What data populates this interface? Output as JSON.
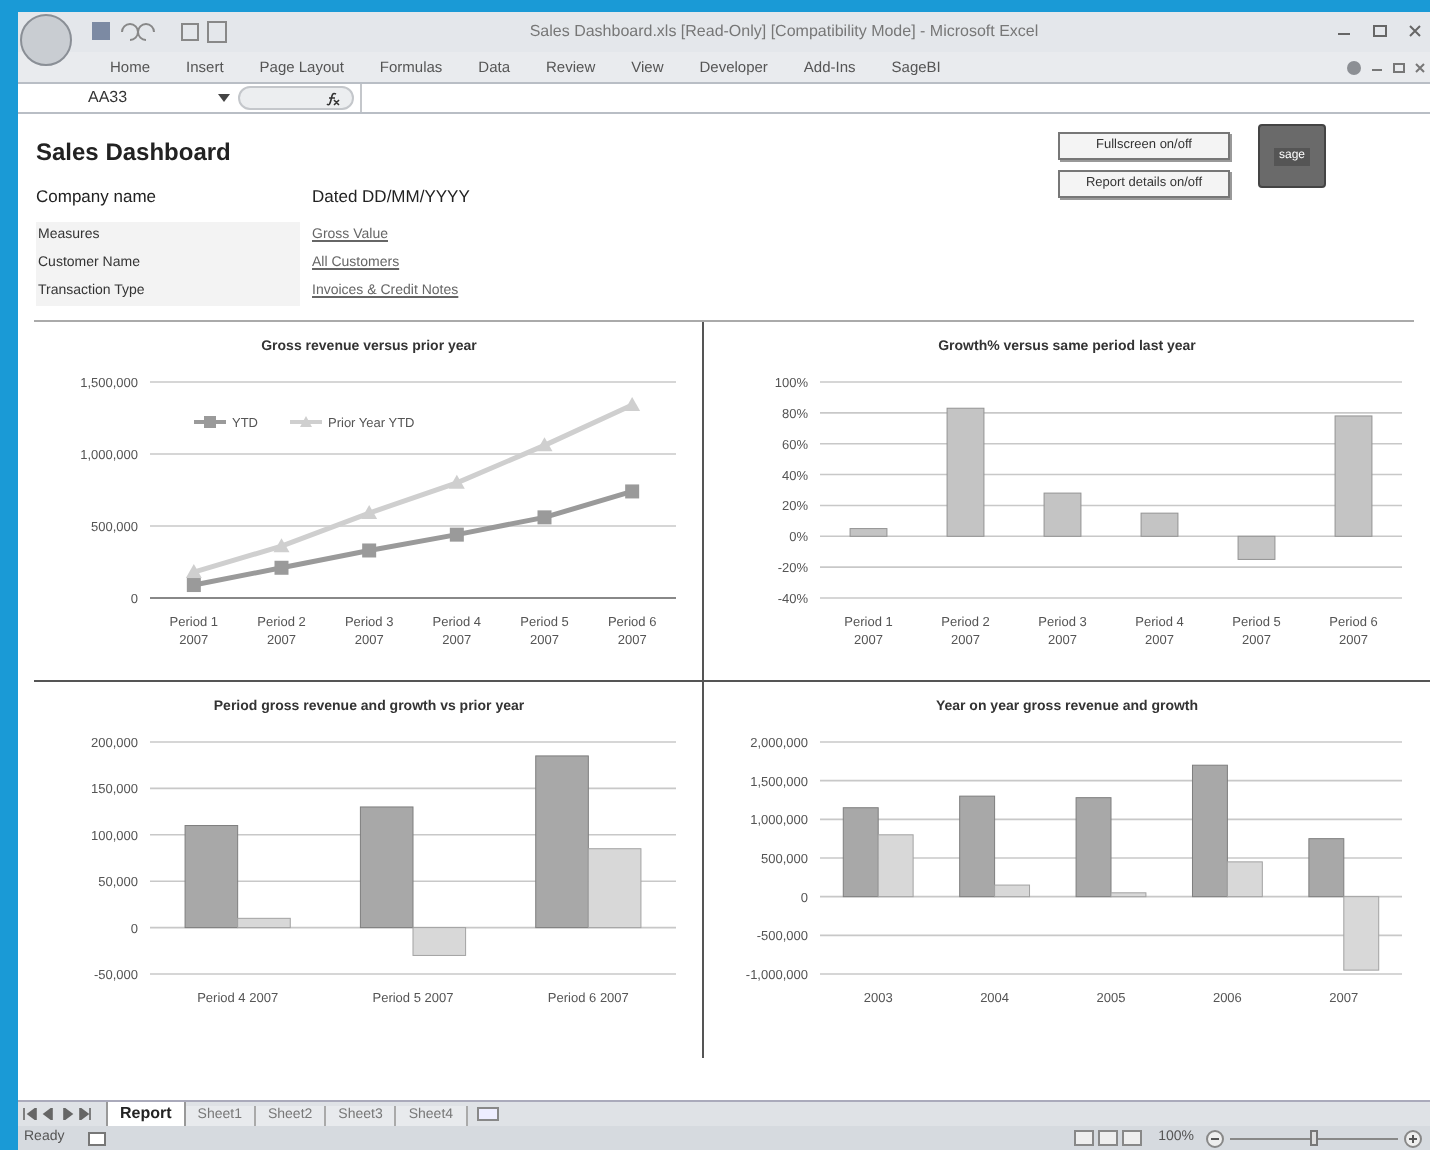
{
  "window": {
    "title": "Sales Dashboard.xls  [Read-Only]  [Compatibility Mode] - Microsoft Excel"
  },
  "ribbon_tabs": [
    {
      "label": "Home",
      "selected": false
    },
    {
      "label": "Insert",
      "selected": false
    },
    {
      "label": "Page Layout",
      "selected": false
    },
    {
      "label": "Formulas",
      "selected": false
    },
    {
      "label": "Data",
      "selected": false
    },
    {
      "label": "Review",
      "selected": false
    },
    {
      "label": "View",
      "selected": false
    },
    {
      "label": "Developer",
      "selected": false
    },
    {
      "label": "Add-Ins",
      "selected": false
    },
    {
      "label": "SageBI",
      "selected": false
    }
  ],
  "formula_bar": {
    "name_box": "AA33"
  },
  "report": {
    "title": "Sales Dashboard",
    "company": "Company name",
    "dated": "Dated DD/MM/YYYY",
    "filters": [
      {
        "label": "Measures",
        "value": "Gross Value"
      },
      {
        "label": "Customer Name",
        "value": "All Customers"
      },
      {
        "label": "Transaction Type",
        "value": "Invoices & Credit Notes"
      }
    ],
    "buttons": [
      "Fullscreen on/off",
      "Report details on/off"
    ],
    "logo": "sage"
  },
  "charts": [
    {
      "chart_data": {
        "type": "line",
        "title": "Gross revenue versus prior year",
        "categories": [
          "Period 1 2007",
          "Period 2 2007",
          "Period 3 2007",
          "Period 4 2007",
          "Period 5 2007",
          "Period 6 2007"
        ],
        "series": [
          {
            "name": "YTD",
            "color": "#9a9a9a",
            "marker": "square",
            "values": [
              90000,
              210000,
              330000,
              440000,
              560000,
              740000
            ]
          },
          {
            "name": "Prior Year YTD",
            "color": "#cfcfcf",
            "marker": "triangle",
            "values": [
              180000,
              360000,
              590000,
              800000,
              1060000,
              1340000
            ]
          }
        ],
        "legend": "upper left",
        "grid": true,
        "ylim": [
          0,
          1500000
        ],
        "yticks": [
          {
            "value": 0,
            "label": "0"
          },
          {
            "value": 500000,
            "label": "500,000"
          },
          {
            "value": 1000000,
            "label": "1,000,000"
          },
          {
            "value": 1500000,
            "label": "1,500,000"
          }
        ]
      }
    },
    {
      "chart_data": {
        "type": "bar",
        "title": "Growth% versus same period last year",
        "categories": [
          "Period 1 2007",
          "Period 2 2007",
          "Period 3 2007",
          "Period 4 2007",
          "Period 5 2007",
          "Period 6 2007"
        ],
        "series": [
          {
            "color": "#c4c4c4",
            "values": [
              5,
              83,
              28,
              15,
              -15,
              78
            ]
          }
        ],
        "grid": true,
        "ylim": [
          -40,
          100
        ],
        "yticks": [
          {
            "value": -40,
            "label": "-40%"
          },
          {
            "value": -20,
            "label": "-20%"
          },
          {
            "value": 0,
            "label": "0%"
          },
          {
            "value": 20,
            "label": "20%"
          },
          {
            "value": 40,
            "label": "40%"
          },
          {
            "value": 60,
            "label": "60%"
          },
          {
            "value": 80,
            "label": "80%"
          },
          {
            "value": 100,
            "label": "100%"
          }
        ]
      }
    },
    {
      "chart_data": {
        "type": "bar",
        "title": "Period  gross revenue and growth vs prior year",
        "categories": [
          "Period 4 2007",
          "Period 5 2007",
          "Period 6 2007"
        ],
        "series": [
          {
            "color": "#a8a8a8",
            "values": [
              110000,
              130000,
              185000
            ]
          },
          {
            "color": "#d8d8d8",
            "values": [
              10000,
              -30000,
              85000
            ]
          }
        ],
        "grid": true,
        "ylim": [
          -50000,
          200000
        ],
        "yticks": [
          {
            "value": -50000,
            "label": "-50,000"
          },
          {
            "value": 0,
            "label": "0"
          },
          {
            "value": 50000,
            "label": "50,000"
          },
          {
            "value": 100000,
            "label": "100,000"
          },
          {
            "value": 150000,
            "label": "150,000"
          },
          {
            "value": 200000,
            "label": "200,000"
          }
        ]
      }
    },
    {
      "chart_data": {
        "type": "bar",
        "title": "Year on year gross revenue and growth",
        "categories": [
          "2003",
          "2004",
          "2005",
          "2006",
          "2007"
        ],
        "series": [
          {
            "color": "#a8a8a8",
            "values": [
              1150000,
              1300000,
              1280000,
              1700000,
              750000
            ]
          },
          {
            "color": "#d8d8d8",
            "values": [
              800000,
              150000,
              50000,
              450000,
              -950000
            ]
          }
        ],
        "grid": true,
        "ylim": [
          -1000000,
          2000000
        ],
        "yticks": [
          {
            "value": -1000000,
            "label": "-1,000,000"
          },
          {
            "value": -500000,
            "label": "-500,000"
          },
          {
            "value": 0,
            "label": "0"
          },
          {
            "value": 500000,
            "label": "500,000"
          },
          {
            "value": 1000000,
            "label": "1,000,000"
          },
          {
            "value": 1500000,
            "label": "1,500,000"
          },
          {
            "value": 2000000,
            "label": "2,000,000"
          }
        ]
      }
    }
  ],
  "sheet_tabs": [
    {
      "label": "Report",
      "selected": true
    },
    {
      "label": "Sheet1",
      "selected": false
    },
    {
      "label": "Sheet2",
      "selected": false
    },
    {
      "label": "Sheet3",
      "selected": false
    },
    {
      "label": "Sheet4",
      "selected": false
    }
  ],
  "status_bar": {
    "status": "Ready",
    "zoom": "100%",
    "zoom_slider": {
      "level": 0.5
    }
  }
}
